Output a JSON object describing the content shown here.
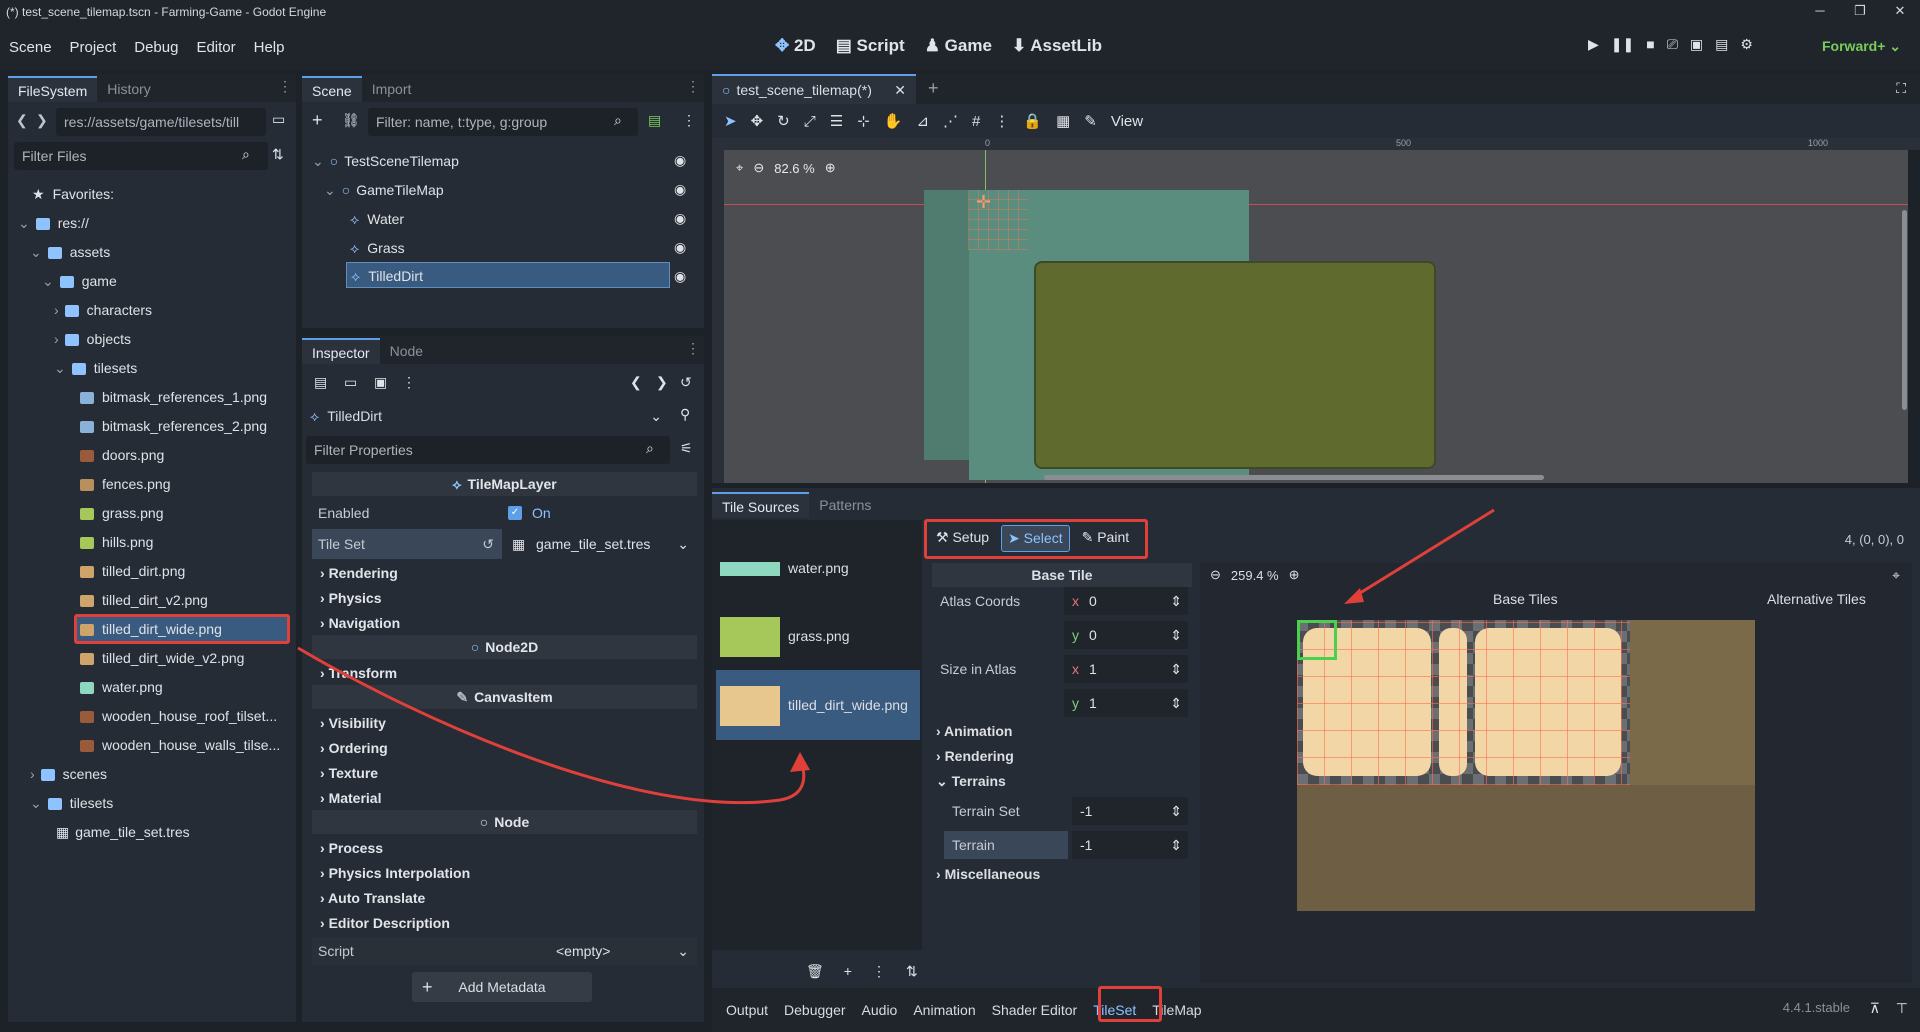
{
  "window": {
    "title": "(*) test_scene_tilemap.tscn - Farming-Game - Godot Engine"
  },
  "menu": [
    "Scene",
    "Project",
    "Debug",
    "Editor",
    "Help"
  ],
  "modes": {
    "d2": "2D",
    "script": "Script",
    "game": "Game",
    "assetlib": "AssetLib"
  },
  "renderer": "Forward+",
  "filesystem": {
    "tabs": [
      "FileSystem",
      "History"
    ],
    "path": "res://assets/game/tilesets/till",
    "filter_placeholder": "Filter Files",
    "items": [
      "Favorites:",
      "res://",
      "assets",
      "game",
      "characters",
      "objects",
      "tilesets",
      "bitmask_references_1.png",
      "bitmask_references_2.png",
      "doors.png",
      "fences.png",
      "grass.png",
      "hills.png",
      "tilled_dirt.png",
      "tilled_dirt_v2.png",
      "tilled_dirt_wide.png",
      "tilled_dirt_wide_v2.png",
      "water.png",
      "wooden_house_roof_tilset...",
      "wooden_house_walls_tilse...",
      "scenes",
      "tilesets",
      "game_tile_set.tres"
    ]
  },
  "scene": {
    "tabs": [
      "Scene",
      "Import"
    ],
    "filter_placeholder": "Filter: name, t:type, g:group",
    "nodes": [
      "TestSceneTilemap",
      "GameTileMap",
      "Water",
      "Grass",
      "TilledDirt"
    ]
  },
  "inspector": {
    "tabs": [
      "Inspector",
      "Node"
    ],
    "node_name": "TilledDirt",
    "filter_placeholder": "Filter Properties",
    "class_tilemaplayer": "TileMapLayer",
    "enabled_label": "Enabled",
    "enabled_value": "On",
    "tileset_label": "Tile Set",
    "tileset_value": "game_tile_set.tres",
    "groups1": [
      "Rendering",
      "Physics",
      "Navigation"
    ],
    "class_node2d": "Node2D",
    "groups2": [
      "Transform"
    ],
    "class_canvasitem": "CanvasItem",
    "groups3": [
      "Visibility",
      "Ordering",
      "Texture",
      "Material"
    ],
    "class_node": "Node",
    "groups4": [
      "Process",
      "Physics Interpolation",
      "Auto Translate",
      "Editor Description"
    ],
    "script_label": "Script",
    "script_value": "<empty>",
    "add_metadata": "Add Metadata"
  },
  "editor": {
    "tab": "test_scene_tilemap(*)",
    "view": "View",
    "zoom": "82.6 %",
    "ruler": [
      "0",
      "500",
      "1000"
    ]
  },
  "tileset_panel": {
    "tabs": [
      "Tile Sources",
      "Patterns"
    ],
    "sources": [
      "water.png",
      "grass.png",
      "tilled_dirt_wide.png"
    ],
    "modes": [
      "Setup",
      "Select",
      "Paint"
    ],
    "coords_readout": "4, (0, 0), 0",
    "base_tile": "Base Tile",
    "atlas_coords": "Atlas Coords",
    "ax": "0",
    "ay": "0",
    "size_in_atlas": "Size in Atlas",
    "sx": "1",
    "sy": "1",
    "groups": [
      "Animation",
      "Rendering",
      "Terrains"
    ],
    "terrain_set_label": "Terrain Set",
    "terrain_set": "-1",
    "terrain_label": "Terrain",
    "terrain": "-1",
    "misc": "Miscellaneous",
    "zoom": "259.4 %",
    "base_tiles": "Base Tiles",
    "alt_tiles": "Alternative Tiles",
    "xlabel": "x",
    "ylabel": "y"
  },
  "bottom": {
    "tabs": [
      "Output",
      "Debugger",
      "Audio",
      "Animation",
      "Shader Editor",
      "TileSet",
      "TileMap"
    ],
    "version": "4.4.1.stable"
  }
}
